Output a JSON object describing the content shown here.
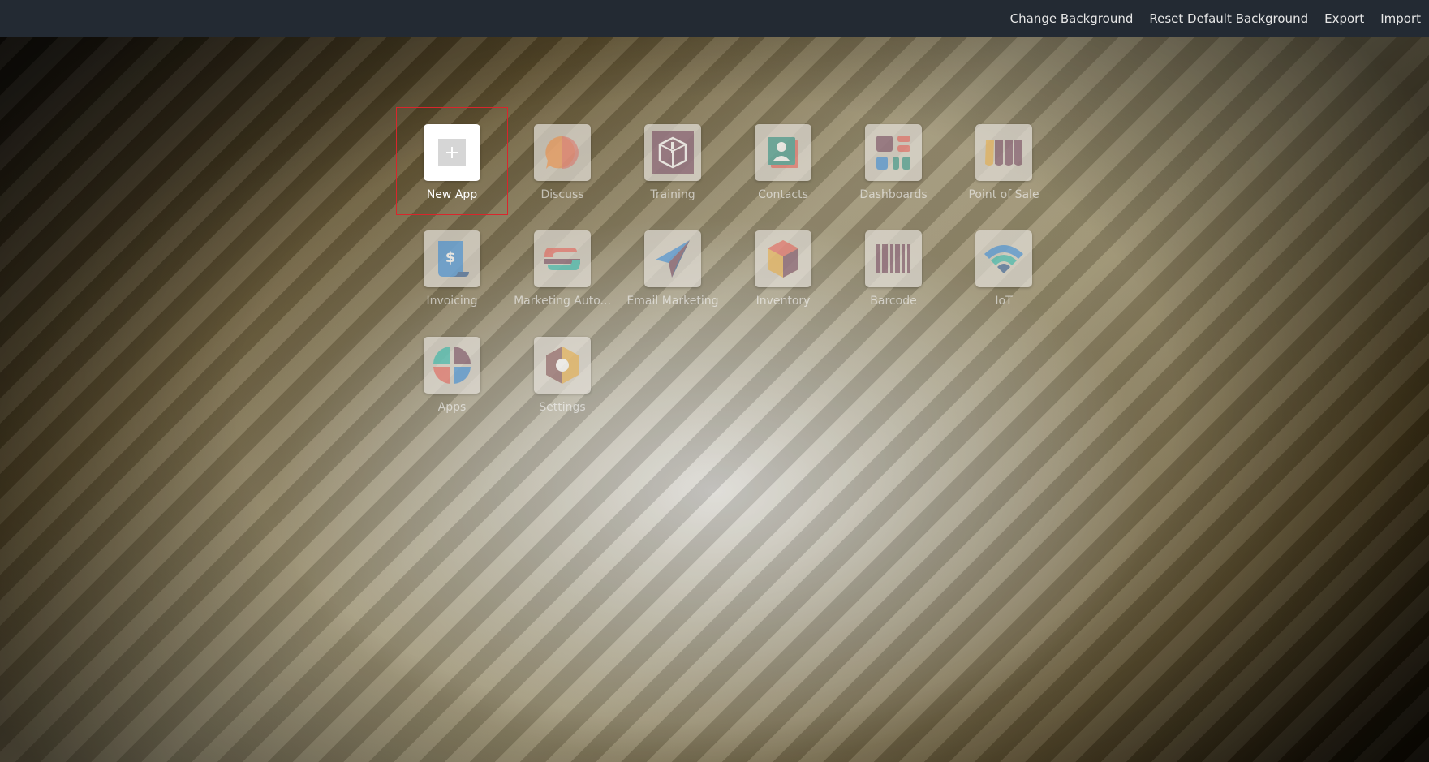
{
  "topbar": {
    "change_background": "Change Background",
    "reset_background": "Reset Default Background",
    "export": "Export",
    "import": "Import"
  },
  "apps": [
    {
      "name": "New App",
      "icon": "plus-icon",
      "selected": true
    },
    {
      "name": "Discuss",
      "icon": "chat-bubble-icon"
    },
    {
      "name": "Training",
      "icon": "training-box-icon"
    },
    {
      "name": "Contacts",
      "icon": "contact-card-icon"
    },
    {
      "name": "Dashboards",
      "icon": "dashboard-icon"
    },
    {
      "name": "Point of Sale",
      "icon": "shop-awning-icon"
    },
    {
      "name": "Invoicing",
      "icon": "invoice-dollar-icon"
    },
    {
      "name": "Marketing Auto...",
      "icon": "marketing-automation-icon"
    },
    {
      "name": "Email Marketing",
      "icon": "paper-plane-icon"
    },
    {
      "name": "Inventory",
      "icon": "inventory-box-icon"
    },
    {
      "name": "Barcode",
      "icon": "barcode-icon"
    },
    {
      "name": "IoT",
      "icon": "wifi-icon"
    },
    {
      "name": "Apps",
      "icon": "apps-quadrant-icon"
    },
    {
      "name": "Settings",
      "icon": "settings-hexagon-icon"
    }
  ],
  "colors": {
    "topbar_bg": "#232a33",
    "selection_outline": "#d9262c"
  }
}
